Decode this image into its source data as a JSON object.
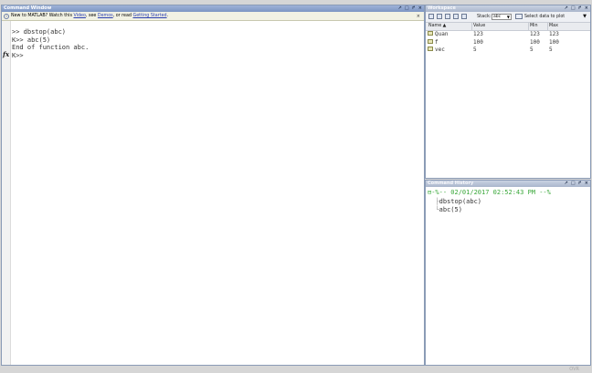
{
  "command_window": {
    "title": "Command Window",
    "notice": {
      "prefix": "New to MATLAB? Watch this ",
      "link_videos": "Video",
      "mid1": ", see ",
      "link_demos": "Demos",
      "mid2": ", or read ",
      "link_getting_started": "Getting Started",
      "suffix": "."
    },
    "lines": [
      ">> dbstop(abc)",
      "K>> abc(5)",
      "End of function abc.",
      "K>>"
    ],
    "fx_label": "fx"
  },
  "workspace": {
    "title": "Workspace",
    "stack_label": "Stack:",
    "stack_value": "abc",
    "plot_label": "Select data to plot",
    "columns": [
      "Name ▲",
      "Value",
      "Min",
      "Max"
    ],
    "variables": [
      {
        "name": "Quan",
        "value": "123",
        "min": "123",
        "max": "123"
      },
      {
        "name": "f",
        "value": "100",
        "min": "100",
        "max": "100"
      },
      {
        "name": "vec",
        "value": "5",
        "min": "5",
        "max": "5"
      }
    ]
  },
  "history": {
    "title": "Command History",
    "session": "⊟-%-- 02/01/2017 02:52:43 PM --%",
    "commands": [
      "dbstop(abc)",
      "abc(5)"
    ]
  },
  "status": {
    "mode": "OVR"
  },
  "colors": {
    "titlebar": "#7d95c2",
    "history_timestamp": "#3aa83a",
    "link": "#2a3eb0"
  }
}
